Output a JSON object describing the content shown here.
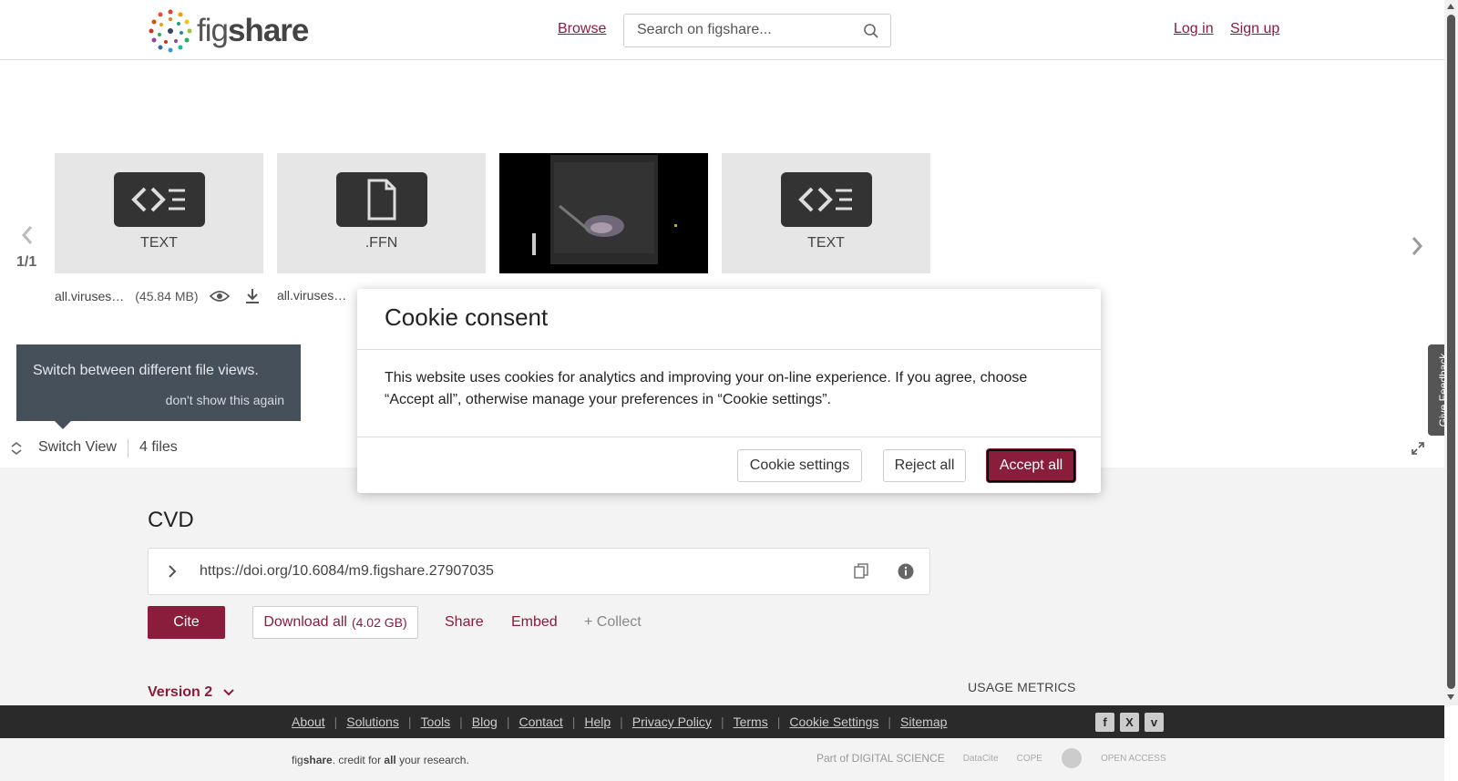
{
  "header": {
    "logo_text_light": "fig",
    "logo_text_bold": "share",
    "browse": "Browse",
    "search_placeholder": "Search on figshare...",
    "login": "Log in",
    "signup": "Sign up"
  },
  "carousel": {
    "pager": "1/1",
    "files": [
      {
        "type": "TEXT",
        "name": "all.viruses…",
        "size": "(45.84 MB)"
      },
      {
        "type": ".FFN",
        "name": "all.viruses…"
      },
      {
        "type": "image"
      },
      {
        "type": "TEXT"
      }
    ]
  },
  "tip": {
    "text": "Switch between different file views.",
    "dismiss": "don't show this again"
  },
  "switch_view": {
    "label": "Switch View",
    "files_count": "4 files"
  },
  "item": {
    "title": "CVD",
    "doi": "https://doi.org/10.6084/m9.figshare.27907035",
    "cite": "Cite",
    "download_all": "Download all",
    "download_size": "(4.02 GB)",
    "share": "Share",
    "embed": "Embed",
    "collect": "+ Collect",
    "version": "Version 2",
    "usage_metrics": "USAGE METRICS"
  },
  "footer": {
    "links": [
      "About",
      "Solutions",
      "Tools",
      "Blog",
      "Contact",
      "Help",
      "Privacy Policy",
      "Terms",
      "Cookie Settings",
      "Sitemap"
    ],
    "credit_fig": "fig",
    "credit_share": "share",
    "credit_mid": ". credit for ",
    "credit_all": "all",
    "credit_end": " your research.",
    "partner_ds": "Part of DIGITAL SCIENCE",
    "partner_datacite": "DataCite",
    "partner_cope": "COPE",
    "partner_oa": "OPEN ACCESS"
  },
  "feedback": "Give Feedback",
  "cookie_modal": {
    "title": "Cookie consent",
    "body": "This website uses cookies for analytics and improving your on-line experience. If you agree, choose “Accept all”, otherwise manage your preferences in “Cookie settings”.",
    "settings": "Cookie settings",
    "reject": "Reject all",
    "accept": "Accept all"
  },
  "colors": {
    "brand": "#8a1c3c",
    "footer_dark": "#2a2a2a",
    "tip_bg": "#45505a"
  }
}
